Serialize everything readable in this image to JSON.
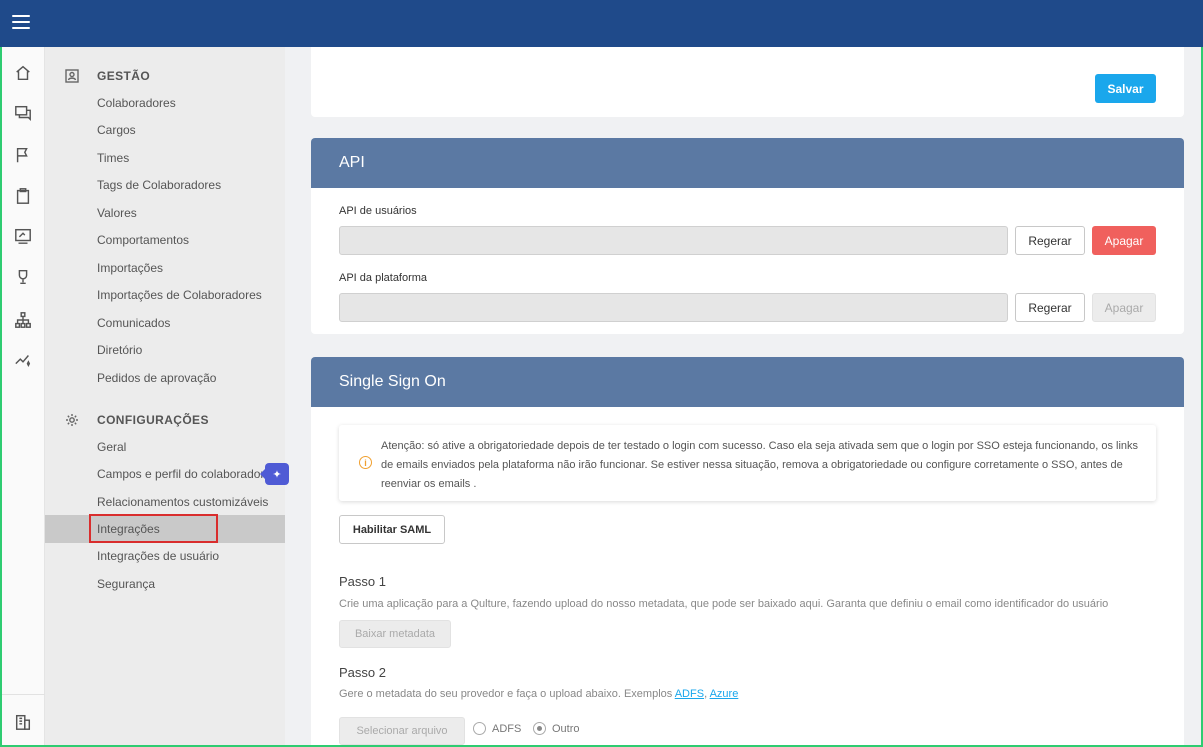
{
  "sidebar": {
    "gestao_title": "GESTÃO",
    "gestao_items": [
      "Colaboradores",
      "Cargos",
      "Times",
      "Tags de Colaboradores",
      "Valores",
      "Comportamentos",
      "Importações",
      "Importações de Colaboradores",
      "Comunicados",
      "Diretório",
      "Pedidos de aprovação"
    ],
    "config_title": "CONFIGURAÇÕES",
    "config_items": [
      "Geral",
      "Campos e perfil do colaborador",
      "Relacionamentos customizáveis",
      "Integrações",
      "Integrações de usuário",
      "Segurança"
    ],
    "active_item": "Integrações"
  },
  "top_card": {
    "save_label": "Salvar"
  },
  "api": {
    "title": "API",
    "users_label": "API de usuários",
    "platform_label": "API da plataforma",
    "regenerate_label": "Regerar",
    "delete_label": "Apagar"
  },
  "sso": {
    "title": "Single Sign On",
    "alert_text": "Atenção: só ative a obrigatoriedade depois de ter testado o login com sucesso. Caso ela seja ativada sem que o login por SSO esteja funcionando, os links de emails enviados pela plataforma não irão funcionar. Se estiver nessa situação, remova a obrigatoriedade ou configure corretamente o SSO, antes de reenviar os emails .",
    "enable_saml_label": "Habilitar SAML",
    "step1_title": "Passo 1",
    "step1_desc": "Crie uma aplicação para a Qulture, fazendo upload do nosso metadata, que pode ser baixado aqui. Garanta que definiu o email como identificador do usuário",
    "download_metadata_label": "Baixar metadata",
    "step2_title": "Passo 2",
    "step2_desc": "Gere o metadata do seu provedor e faça o upload abaixo. Exemplos",
    "link_adfs": "ADFS",
    "link_sep": ",",
    "link_azure": "Azure",
    "select_file_label": "Selecionar arquivo",
    "radio_adfs": "ADFS",
    "radio_outro": "Outro",
    "radio_selected": "Outro"
  },
  "colors": {
    "topbar": "#1f4a8a",
    "card_header": "#5b79a3",
    "primary": "#1aa7ec",
    "danger": "#f0605d",
    "highlight": "#d92d2d"
  }
}
